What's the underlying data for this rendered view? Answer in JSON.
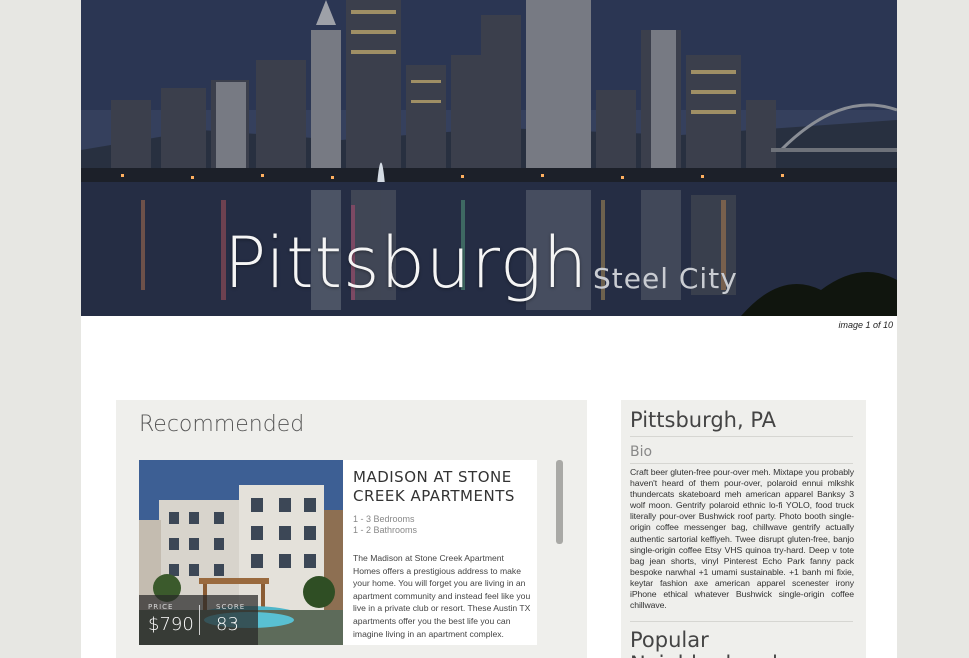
{
  "hero": {
    "city": "Pittsburgh",
    "nickname": "Steel City",
    "image_counter": "image 1 of 10"
  },
  "recommended": {
    "heading": "Recommended",
    "listing": {
      "name": "MADISON AT STONE CREEK APARTMENTS",
      "bedrooms": "1 - 3 Bedrooms",
      "bathrooms": "1 - 2 Bathrooms",
      "description": "The Madison at Stone Creek Apartment Homes offers a prestigious address to make your home. You will forget you are living in an apartment community and instead feel like you live in a private club or resort. These Austin TX apartments offer you the best life you can imagine living in an apartment complex.",
      "price_label": "PRICE",
      "price": "$790",
      "score_label": "SCORE",
      "score": "83"
    }
  },
  "side": {
    "title": "Pittsburgh, PA",
    "bio_heading": "Bio",
    "bio_text": "Craft beer gluten-free pour-over meh. Mixtape you probably haven't heard of them pour-over, polaroid ennui mlkshk thundercats skateboard meh american apparel Banksy 3 wolf moon. Gentrify polaroid ethnic lo-fi YOLO, food truck literally pour-over Bushwick roof party. Photo booth single-origin coffee messenger bag, chillwave gentrify actually authentic sartorial keffiyeh. Twee disrupt gluten-free, banjo single-origin coffee Etsy VHS quinoa try-hard. Deep v tote bag jean shorts, vinyl Pinterest Echo Park fanny pack bespoke narwhal +1 umami sustainable. +1 banh mi fixie, keytar fashion axe american apparel scenester irony iPhone ethical whatever Bushwick single-origin coffee chillwave.",
    "neighborhoods_heading": "Popular Neighborhoods"
  },
  "colors": {
    "background": "#e7e7e3",
    "panel": "#efefec",
    "page": "#ffffff"
  }
}
